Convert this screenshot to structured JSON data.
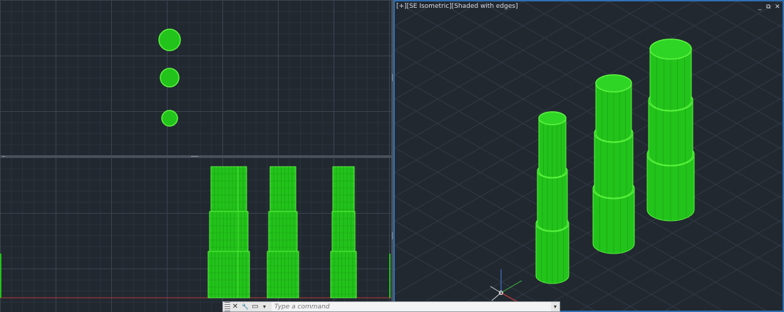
{
  "iso_viewport": {
    "label": "[+][SE Isometric][Shaded with edges]",
    "controls": [
      "_",
      "⧉",
      "✕"
    ]
  },
  "command_line": {
    "placeholder": "Type a command",
    "close_glyph": "✕",
    "wrench_glyph": "🔧",
    "recent_glyph": "▭",
    "dropdown_glyph": "▾"
  },
  "colors": {
    "background": "#212830",
    "solid_fill": "#22c31a",
    "solid_edge": "#5bf53f",
    "active_border": "#2f6fb1",
    "ucs_x": "#d04040",
    "ucs_y": "#3fbf3f",
    "ucs_z": "#4a7de0"
  },
  "icons": [
    "close-icon",
    "wrench-icon",
    "recent-commands-icon",
    "dropdown-arrow-icon",
    "minimize-icon",
    "restore-icon",
    "ucs-icon"
  ]
}
